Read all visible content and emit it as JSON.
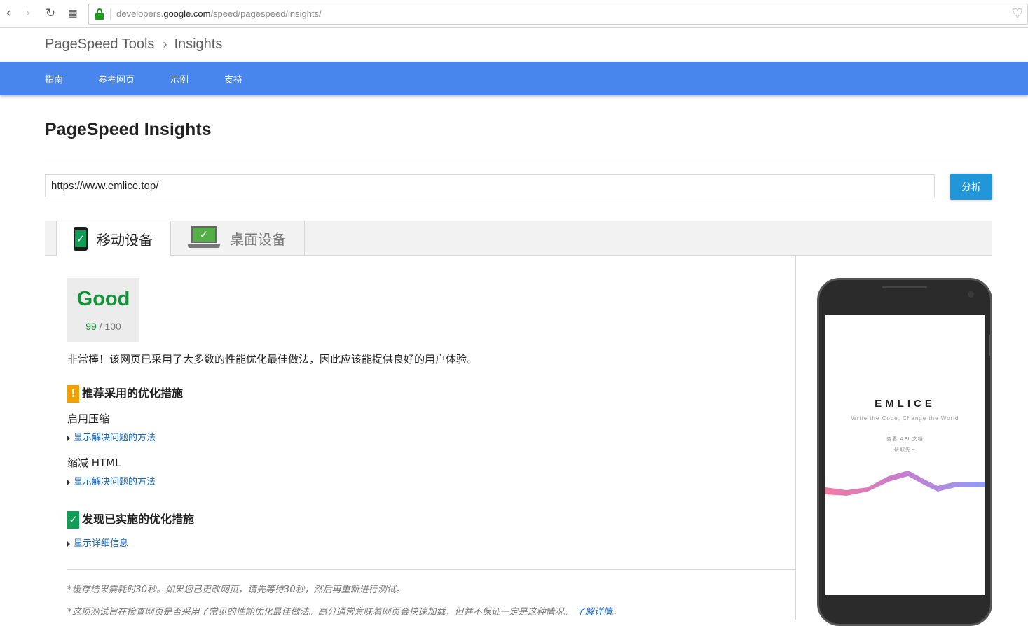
{
  "browser": {
    "url_host_prefix": "developers.",
    "url_host_domain": "google.com",
    "url_path": "/speed/pagespeed/insights/"
  },
  "header": {
    "breadcrumb_root": "PageSpeed Tools",
    "breadcrumb_current": "Insights"
  },
  "nav": {
    "items": [
      "指南",
      "参考网页",
      "示例",
      "支持"
    ]
  },
  "main": {
    "title": "PageSpeed Insights",
    "url_value": "https://www.emlice.top/",
    "analyze_label": "分析",
    "tabs": [
      {
        "label": "移动设备",
        "active": true
      },
      {
        "label": "桌面设备",
        "active": false
      }
    ]
  },
  "result": {
    "rating": "Good",
    "score": "99",
    "score_max": "/ 100",
    "score_color": "#139438",
    "summary": "非常棒！该网页已采用了大多数的性能优化最佳做法，因此应该能提供良好的用户体验。",
    "suggest_title": "推荐采用的优化措施",
    "suggest_badge": "!",
    "rules": [
      {
        "name": "启用压缩",
        "link": "显示解决问题的方法"
      },
      {
        "name": "缩减 HTML",
        "link": "显示解决问题的方法"
      }
    ],
    "passed_title": "发现已实施的优化措施",
    "passed_badge": "✓",
    "passed_link": "显示详细信息"
  },
  "footnotes": {
    "cache": "*缓存结果需耗时30秒。如果您已更改网页，请先等待30秒，然后再重新进行测试。",
    "disclaimer": "*这项测试旨在检查网页是否采用了常见的性能优化最佳做法。高分通常意味着网页会快速加载，但并不保证一定是这种情况。",
    "learn_more": "了解详情",
    "learn_more_suffix": "。"
  },
  "preview": {
    "site_name": "EMLICE",
    "tagline": "Write the Code, Change the World",
    "link1": "查看 API 文档",
    "link2": "研取先~"
  },
  "colors": {
    "navbar": "#4885ed",
    "button": "#2196d8",
    "good": "#139438",
    "warn": "#f0a000",
    "link": "#1565c0"
  }
}
